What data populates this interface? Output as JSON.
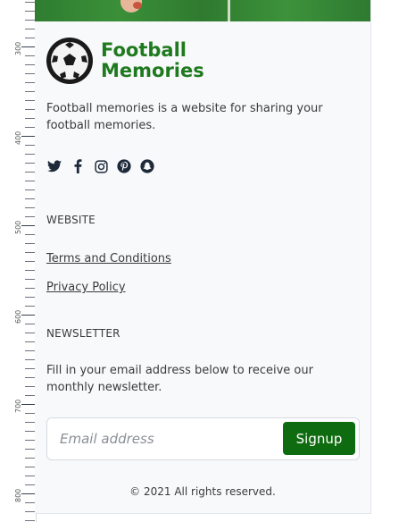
{
  "ruler": {
    "labels": [
      "300",
      "400",
      "500",
      "600",
      "700",
      "800"
    ]
  },
  "brand": {
    "logo_icon": "soccer-ball-icon",
    "line1": "Football",
    "line2": "Memories",
    "color": "#1f7a1f"
  },
  "description": "Football memories is a website for sharing your football memories.",
  "social": [
    {
      "name": "twitter-icon"
    },
    {
      "name": "facebook-icon"
    },
    {
      "name": "instagram-icon"
    },
    {
      "name": "pinterest-icon"
    },
    {
      "name": "snapchat-icon"
    }
  ],
  "website": {
    "heading": "WEBSITE",
    "links": [
      "Terms and Conditions",
      "Privacy Policy"
    ]
  },
  "newsletter": {
    "heading": "NEWSLETTER",
    "description": "Fill in your email address below to receive our monthly newsletter.",
    "email_placeholder": "Email address",
    "button_label": "Signup",
    "button_color": "#0f6b0f"
  },
  "footer": {
    "copyright": "© 2021 All rights reserved."
  }
}
